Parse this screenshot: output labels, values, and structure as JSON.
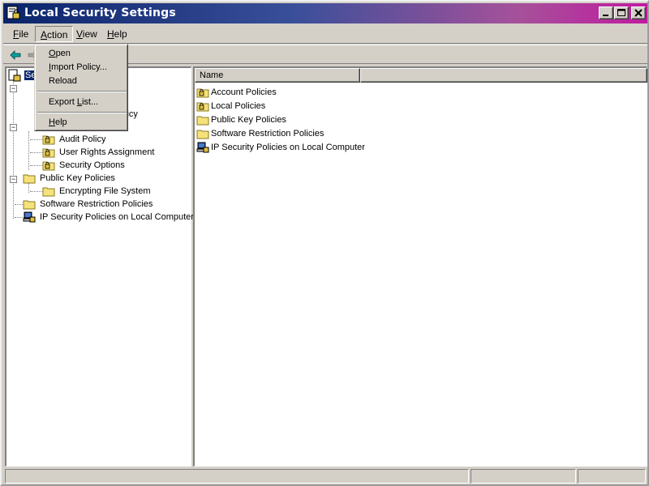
{
  "window": {
    "title": "Local Security Settings",
    "icon": "security-settings-icon"
  },
  "menubar": {
    "items": [
      {
        "label": "File",
        "mnemonic": "F",
        "rest": "ile"
      },
      {
        "label": "Action",
        "mnemonic": "A",
        "rest": "ction"
      },
      {
        "label": "View",
        "mnemonic": "V",
        "rest": "iew"
      },
      {
        "label": "Help",
        "mnemonic": "H",
        "rest": "elp"
      }
    ]
  },
  "action_menu": {
    "items": [
      {
        "label": "Open",
        "mnemonic": "O",
        "rest": "pen"
      },
      {
        "label": "Import Policy...",
        "mnemonic": "I",
        "rest": "mport Policy..."
      },
      {
        "label": "Reload",
        "mnemonic": "",
        "rest": "Reload"
      },
      {
        "label": "Export List...",
        "mnemonic": "",
        "pre": "Export ",
        "mid": "L",
        "post": "ist..."
      },
      {
        "label": "Help",
        "mnemonic": "H",
        "rest": "elp"
      }
    ]
  },
  "tree": {
    "root_visible": "Se",
    "partial_visible": "licy",
    "items": [
      {
        "label": "Audit Policy",
        "icon": "folder-lock-icon"
      },
      {
        "label": "User Rights Assignment",
        "icon": "folder-lock-icon"
      },
      {
        "label": "Security Options",
        "icon": "folder-lock-icon"
      },
      {
        "label": "Public Key Policies",
        "icon": "folder-icon"
      },
      {
        "label": "Encrypting File System",
        "icon": "folder-icon"
      },
      {
        "label": "Software Restriction Policies",
        "icon": "folder-icon"
      },
      {
        "label": "IP Security Policies on Local Computer",
        "icon": "ip-security-icon"
      }
    ]
  },
  "list": {
    "column_name": "Name",
    "rows": [
      {
        "label": "Account Policies",
        "icon": "folder-lock-icon"
      },
      {
        "label": "Local Policies",
        "icon": "folder-lock-icon"
      },
      {
        "label": "Public Key Policies",
        "icon": "folder-icon"
      },
      {
        "label": "Software Restriction Policies",
        "icon": "folder-icon"
      },
      {
        "label": "IP Security Policies on Local Computer",
        "icon": "ip-security-icon"
      }
    ]
  }
}
